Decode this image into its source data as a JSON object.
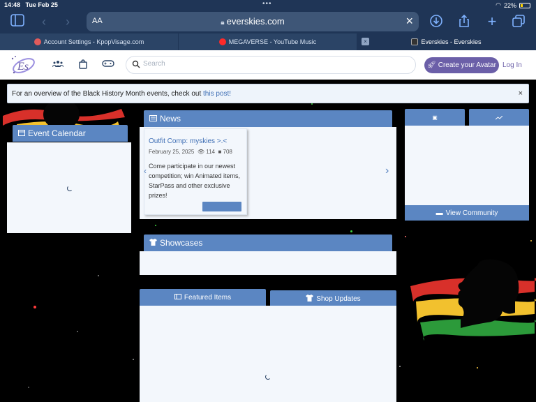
{
  "status": {
    "time": "14:48",
    "date": "Tue Feb 25",
    "battery": "22%"
  },
  "browser": {
    "text_size_label": "AA",
    "url": "everskies.com",
    "tabs": [
      {
        "label": "Account Settings - KpopVisage.com",
        "favicon_color": "#e25b5b"
      },
      {
        "label": "MEGAVERSE - YouTube Music",
        "favicon_color": "#ff2a2a"
      },
      {
        "label": "Everskies - Everskies",
        "favicon_color": "#333333",
        "active": true
      }
    ]
  },
  "header": {
    "search_placeholder": "Search",
    "create_avatar": "Create your Avatar",
    "login": "Log In",
    "brand_color": "#6b5fa8"
  },
  "banner": {
    "text": "For an overview of the Black History Month events, check out ",
    "link": "this post!"
  },
  "event_calendar": {
    "title": "Event Calendar"
  },
  "news": {
    "title": "News",
    "item": {
      "title": "Outfit Comp: myskies >.<",
      "date": "February 25, 2025",
      "views": "114",
      "comments": "708",
      "body": "Come participate in our newest competition; win Animated items, StarPass and other exclusive prizes!"
    }
  },
  "community": {
    "view_label": "View Community"
  },
  "showcases": {
    "title": "Showcases"
  },
  "featured": {
    "featured_items": "Featured Items",
    "shop_updates": "Shop Updates"
  },
  "colors": {
    "accent": "#5b86c2",
    "panel": "#f3f7fc",
    "chrome": "#1f3556"
  }
}
